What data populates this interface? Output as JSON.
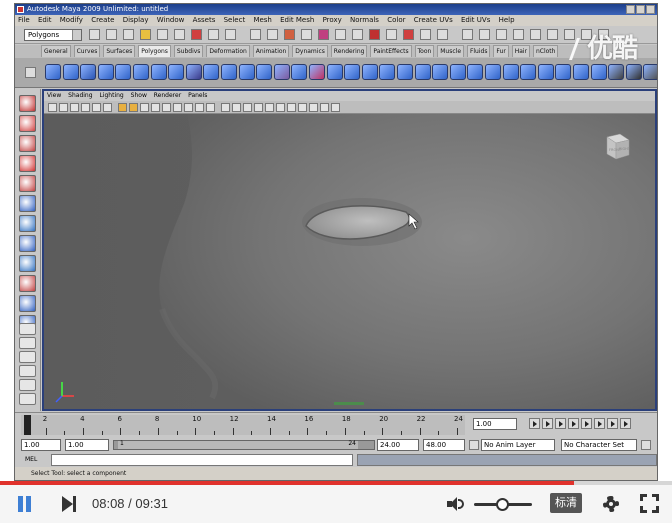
{
  "maya": {
    "title": "Autodesk Maya 2009 Unlimited: untitled",
    "menus": [
      "File",
      "Edit",
      "Modify",
      "Create",
      "Display",
      "Window",
      "Assets",
      "Select",
      "Mesh",
      "Edit Mesh",
      "Proxy",
      "Normals",
      "Color",
      "Create UVs",
      "Edit UVs",
      "Help"
    ],
    "mode": "Polygons",
    "shelf_tabs": [
      "General",
      "Curves",
      "Surfaces",
      "Polygons",
      "Subdivs",
      "Deformation",
      "Animation",
      "Dynamics",
      "Rendering",
      "PaintEffects",
      "Toon",
      "Muscle",
      "Fluids",
      "Fur",
      "Hair",
      "nCloth"
    ],
    "active_shelf_tab": "Polygons",
    "panel_menus": [
      "View",
      "Shading",
      "Lighting",
      "Show",
      "Renderer",
      "Panels"
    ],
    "viewcube_labels": {
      "front": "FRONT",
      "right": "RIGHT"
    },
    "time_ticks": [
      "1",
      "2",
      "4",
      "6",
      "8",
      "10",
      "12",
      "14",
      "16",
      "18",
      "20",
      "22",
      "24"
    ],
    "current_frame": "1.00",
    "range": {
      "start": "1.00",
      "playback_start": "1.00",
      "playback_end": "24.00",
      "end": "48.00",
      "slider_left": "1",
      "slider_right": "24"
    },
    "anim_layer": "No Anim Layer",
    "character_set": "No Character Set",
    "cmd_label": "MEL",
    "help_text": "Select Tool: select a component"
  },
  "watermark": "优酷",
  "player": {
    "current_time": "08:08",
    "total_time": "09:31",
    "time_separator": "/",
    "progress": 0.854,
    "volume": 0.5,
    "quality_label": "标清"
  }
}
